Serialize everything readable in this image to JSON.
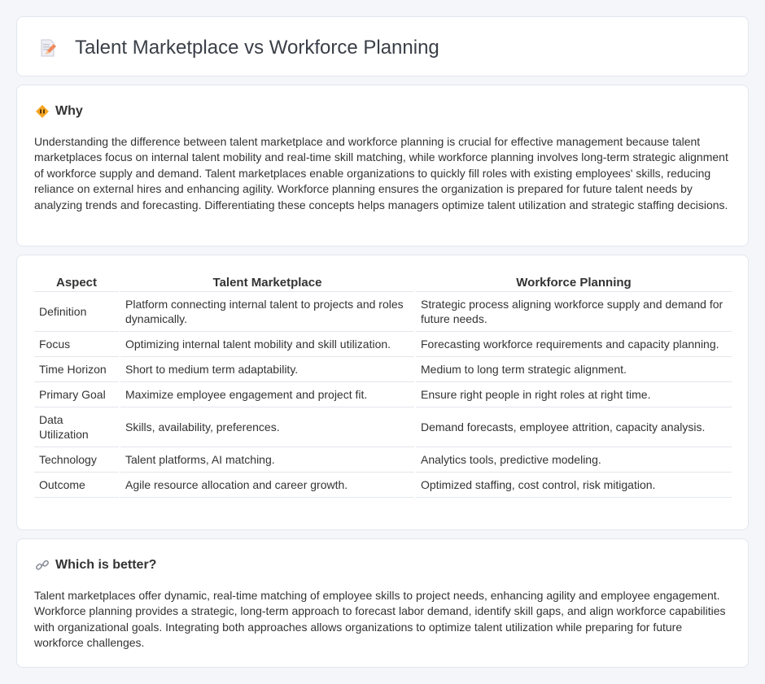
{
  "header": {
    "title": "Talent Marketplace vs Workforce Planning",
    "icon": "document-pencil-icon"
  },
  "why": {
    "title": "Why",
    "icon": "diamond-sign-icon",
    "text": "Understanding the difference between talent marketplace and workforce planning is crucial for effective management because talent marketplaces focus on internal talent mobility and real-time skill matching, while workforce planning involves long-term strategic alignment of workforce supply and demand. Talent marketplaces enable organizations to quickly fill roles with existing employees' skills, reducing reliance on external hires and enhancing agility. Workforce planning ensures the organization is prepared for future talent needs by analyzing trends and forecasting. Differentiating these concepts helps managers optimize talent utilization and strategic staffing decisions."
  },
  "table": {
    "headers": [
      "Aspect",
      "Talent Marketplace",
      "Workforce Planning"
    ],
    "rows": [
      [
        "Definition",
        "Platform connecting internal talent to projects and roles dynamically.",
        "Strategic process aligning workforce supply and demand for future needs."
      ],
      [
        "Focus",
        "Optimizing internal talent mobility and skill utilization.",
        "Forecasting workforce requirements and capacity planning."
      ],
      [
        "Time Horizon",
        "Short to medium term adaptability.",
        "Medium to long term strategic alignment."
      ],
      [
        "Primary Goal",
        "Maximize employee engagement and project fit.",
        "Ensure right people in right roles at right time."
      ],
      [
        "Data Utilization",
        "Skills, availability, preferences.",
        "Demand forecasts, employee attrition, capacity analysis."
      ],
      [
        "Technology",
        "Talent platforms, AI matching.",
        "Analytics tools, predictive modeling."
      ],
      [
        "Outcome",
        "Agile resource allocation and career growth.",
        "Optimized staffing, cost control, risk mitigation."
      ]
    ]
  },
  "better": {
    "title": "Which is better?",
    "icon": "link-icon",
    "text": "Talent marketplaces offer dynamic, real-time matching of employee skills to project needs, enhancing agility and employee engagement. Workforce planning provides a strategic, long-term approach to forecast labor demand, identify skill gaps, and align workforce capabilities with organizational goals. Integrating both approaches allows organizations to optimize talent utilization while preparing for future workforce challenges."
  },
  "colors": {
    "background": "#f4f6fa",
    "card": "#ffffff",
    "border": "#e2e6ee",
    "text": "#333333",
    "accent_orange": "#f0a030"
  }
}
